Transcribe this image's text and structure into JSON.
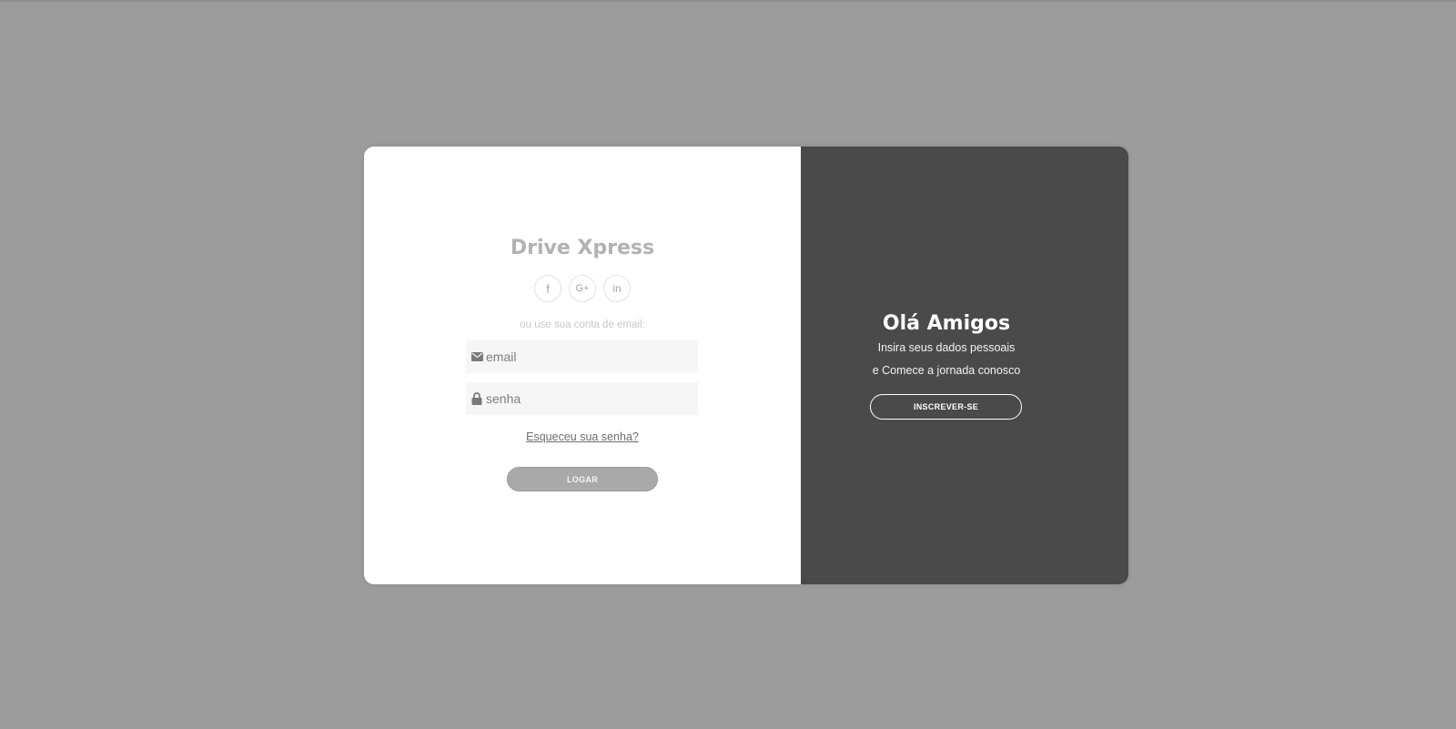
{
  "colors": {
    "page_background": "#9c9c9c",
    "card_left": "#ffffff",
    "card_right": "#4a4a4a",
    "brand_text": "#b2b2b2",
    "login_button": "#a9a9a9"
  },
  "login": {
    "brand": "Drive Xpress",
    "socials": [
      {
        "icon": "facebook-icon",
        "glyph": "f"
      },
      {
        "icon": "google-plus-icon",
        "glyph": "G+"
      },
      {
        "icon": "linkedin-icon",
        "glyph": "in"
      }
    ],
    "hint": "ou use sua conta de email:",
    "email_placeholder": "email",
    "email_icon": "envelope-icon",
    "password_placeholder": "senha",
    "password_icon": "lock-icon",
    "forgot_label": "Esqueceu sua senha?",
    "login_button": "LOGAR"
  },
  "signup_panel": {
    "title": "Olá Amigos",
    "line1": "Insira seus dados pessoais",
    "line2": "e Comece a jornada conosco",
    "signup_button": "INSCREVER-SE"
  }
}
